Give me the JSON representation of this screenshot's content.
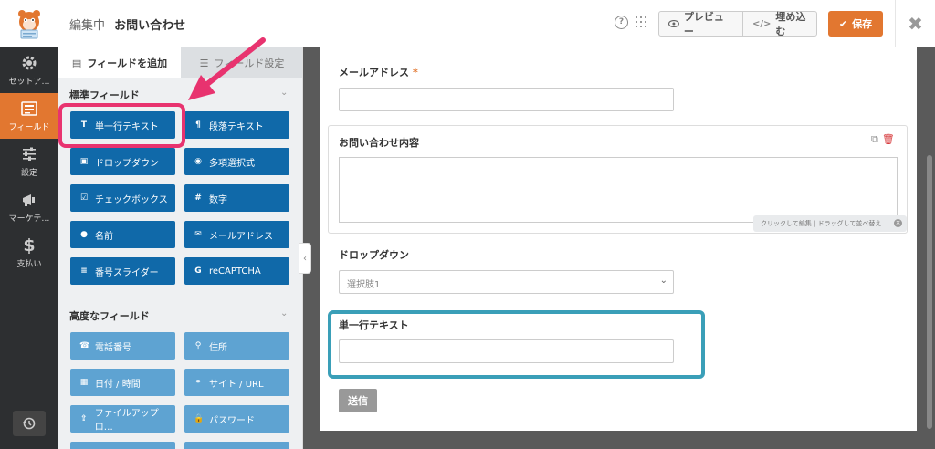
{
  "header": {
    "editing_label": "編集中",
    "form_name": "お問い合わせ",
    "help_icon": "?",
    "preview_label": "プレビュー",
    "embed_label": "埋め込む",
    "save_label": "保存",
    "close_icon": "✖"
  },
  "nav": {
    "items": [
      {
        "label": "セットア…",
        "icon": "gear-icon"
      },
      {
        "label": "フィールド",
        "icon": "fields-icon"
      },
      {
        "label": "設定",
        "icon": "sliders-icon"
      },
      {
        "label": "マーケテ…",
        "icon": "megaphone-icon"
      },
      {
        "label": "支払い",
        "icon": "dollar-icon"
      }
    ]
  },
  "panel": {
    "tab_add": "フィールドを追加",
    "tab_settings": "フィールド設定",
    "standard_title": "標準フィールド",
    "standard_fields": [
      {
        "label": "単一行テキスト",
        "icon": "T"
      },
      {
        "label": "段落テキスト",
        "icon": "¶"
      },
      {
        "label": "ドロップダウン",
        "icon": "▣"
      },
      {
        "label": "多項選択式",
        "icon": "◉"
      },
      {
        "label": "チェックボックス",
        "icon": "☑"
      },
      {
        "label": "数字",
        "icon": "#"
      },
      {
        "label": "名前",
        "icon": "●"
      },
      {
        "label": "メールアドレス",
        "icon": "✉"
      },
      {
        "label": "番号スライダー",
        "icon": "≡"
      },
      {
        "label": "reCAPTCHA",
        "icon": "G"
      }
    ],
    "advanced_title": "高度なフィールド",
    "advanced_fields": [
      {
        "label": "電話番号",
        "icon": "☎"
      },
      {
        "label": "住所",
        "icon": "⚲"
      },
      {
        "label": "日付 / 時間",
        "icon": "▦"
      },
      {
        "label": "サイト / URL",
        "icon": "⚭"
      },
      {
        "label": "ファイルアップロ…",
        "icon": "⇪"
      },
      {
        "label": "パスワード",
        "icon": "🔒"
      }
    ]
  },
  "form": {
    "email_label": "メールアドレス",
    "email_required": "*",
    "message_label": "お問い合わせ内容",
    "tooltip": "クリックして編集 | ドラッグして並べ替え",
    "dropdown_label": "ドロップダウン",
    "dropdown_value": "選択肢1",
    "single_line_label": "単一行テキスト",
    "submit_label": "送信"
  }
}
